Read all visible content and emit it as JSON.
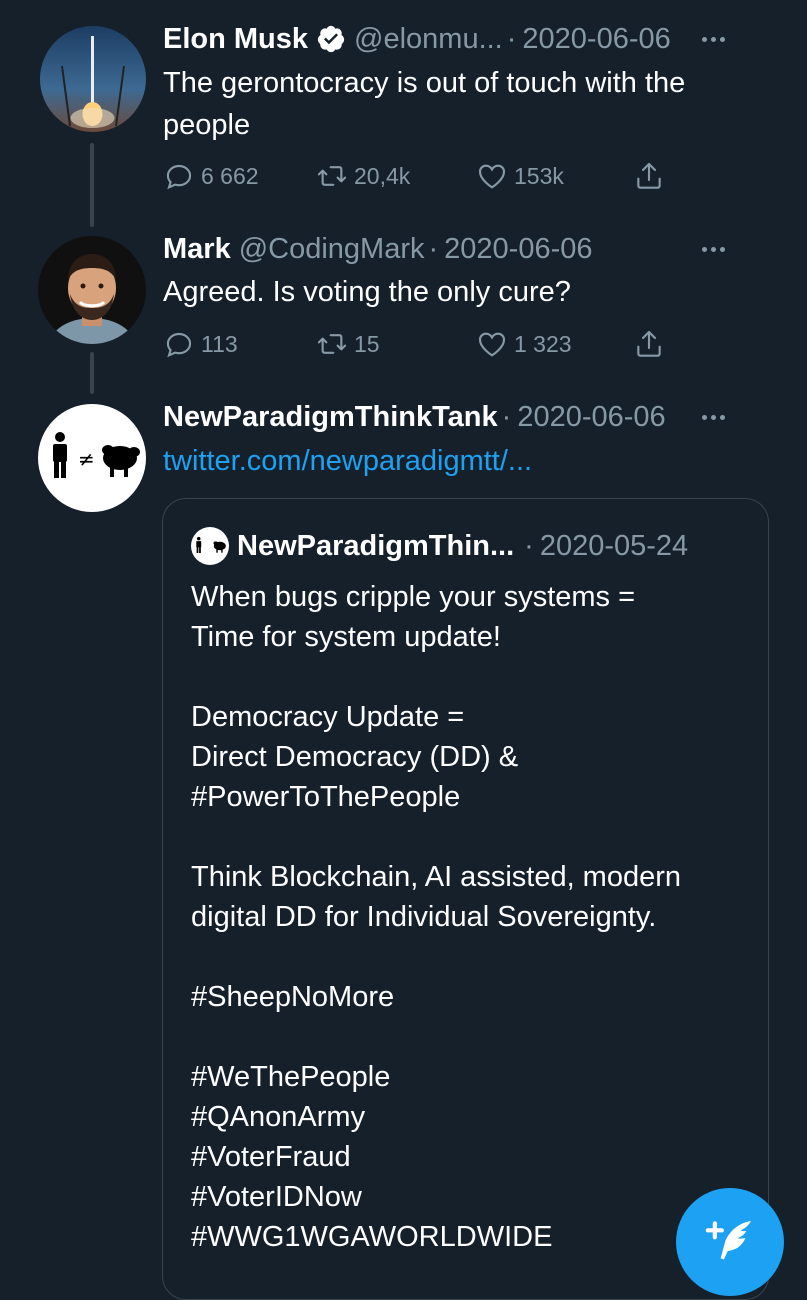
{
  "tweets": [
    {
      "name": "Elon Musk",
      "handle": "@elonmu...",
      "date": "2020-06-06",
      "text": "The gerontocracy is out of touch with the people",
      "replies": "6 662",
      "retweets": "20,4k",
      "likes": "153k",
      "avatar_icon": "rocket-launch-photo"
    },
    {
      "name": "Mark",
      "handle": "@CodingMark",
      "date": "2020-06-06",
      "text": "Agreed. Is voting the only cure?",
      "replies": "113",
      "retweets": "15",
      "likes": "1 323",
      "avatar_icon": "smiling-man-photo"
    },
    {
      "name": "NewParadigmThinkTank",
      "date": "2020-06-06",
      "link": "twitter.com/newparadigmtt/...",
      "avatar_icon": "person-not-equal-sheep-logo",
      "quote": {
        "name": "NewParadigmThin...",
        "date": "2020-05-24",
        "paragraphs": [
          "When bugs cripple your systems =\nTime for system update!",
          "Democracy Update =\nDirect Democracy (DD) &\n#PowerToThePeople",
          "Think Blockchain, AI assisted, modern\ndigital DD for Individual Sovereignty.",
          "#SheepNoMore",
          "#WeThePeople\n#QAnonArmy\n#VoterFraud\n#VoterIDNow\n#WWG1WGAWORLDWIDE"
        ]
      }
    }
  ],
  "separator": "·",
  "icons": {
    "more": "more-horizontal-icon",
    "verified": "verified-badge-icon",
    "compose": "compose-tweet-icon"
  },
  "colors": {
    "background": "#15202b",
    "secondary_text": "#8899a6",
    "accent": "#1da1f2",
    "border": "#38444d"
  }
}
